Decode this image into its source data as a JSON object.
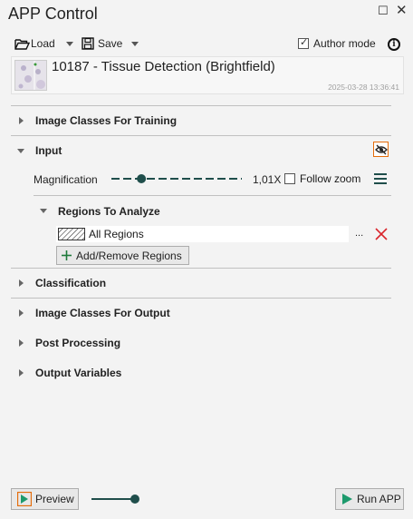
{
  "window": {
    "title": "APP Control"
  },
  "toolbar": {
    "load_label": "Load",
    "save_label": "Save",
    "author_mode_label": "Author mode",
    "author_mode_checked": true
  },
  "app": {
    "name": "10187 - Tissue Detection (Brightfield)",
    "date": "2025-03-28 13:36:41"
  },
  "sections": {
    "image_classes_training": "Image Classes For Training",
    "input": "Input",
    "classification": "Classification",
    "image_classes_output": "Image Classes For Output",
    "post_processing": "Post Processing",
    "output_variables": "Output Variables"
  },
  "input": {
    "magnification_label": "Magnification",
    "magnification_value": "1,01X",
    "magnification_level": 0.23,
    "follow_zoom_label": "Follow zoom",
    "follow_zoom_checked": false,
    "regions_label": "Regions To Analyze",
    "region_value": "All Regions",
    "more_label": "...",
    "add_remove_label": "Add/Remove Regions"
  },
  "footer": {
    "preview_label": "Preview",
    "run_label": "Run APP",
    "preview_slider_level": 1.0
  },
  "colors": {
    "accent_orange": "#e46c0a",
    "run_green": "#1d9a6c",
    "remove_red": "#d9232a",
    "dark_teal": "#1f4e4b"
  }
}
